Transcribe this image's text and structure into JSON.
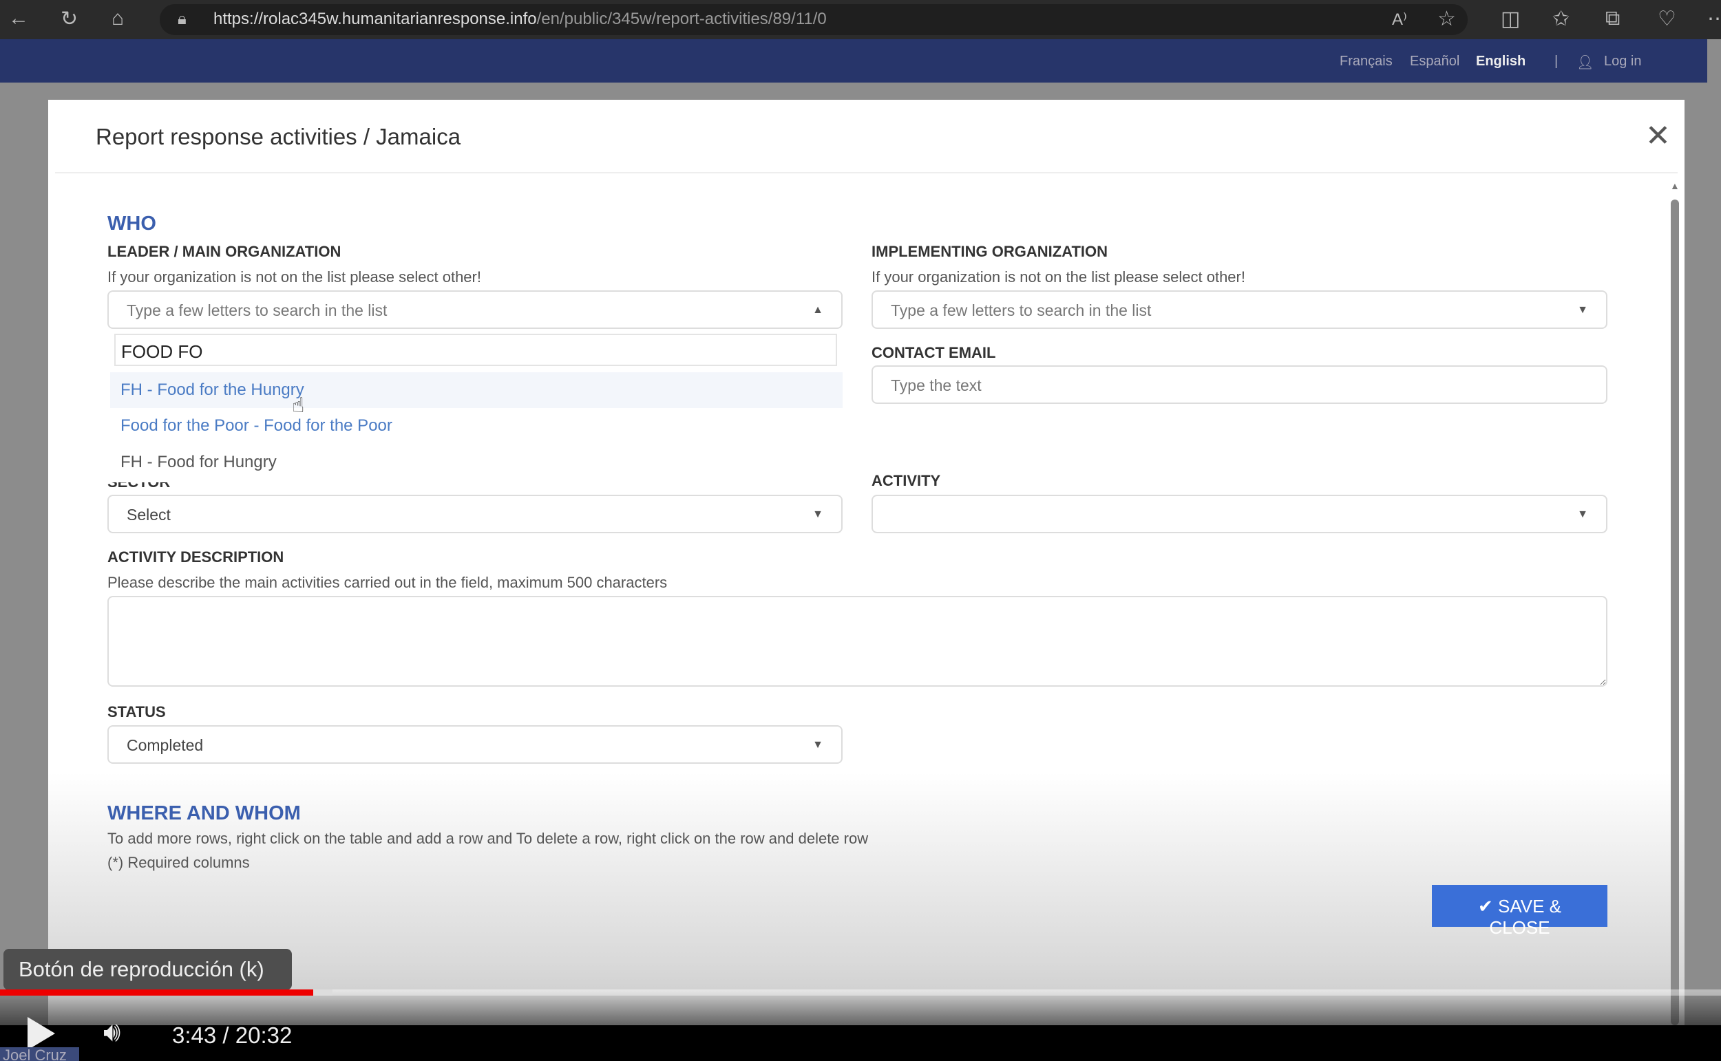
{
  "browser": {
    "url_host": "https://rolac345w.humanitarianresponse.info",
    "url_path": "/en/public/345w/report-activities/89/11/0",
    "icons": [
      "back-icon",
      "refresh-icon",
      "home-icon",
      "lock-icon",
      "read-aloud-icon",
      "favorite-icon",
      "split-screen-icon",
      "favorites-icon",
      "collections-icon",
      "extensions-icon",
      "more-icon"
    ]
  },
  "site": {
    "languages": [
      "Français",
      "Español",
      "English"
    ],
    "login": "Log in"
  },
  "modal": {
    "title": "Report response activities / Jamaica",
    "who": {
      "heading": "WHO",
      "leader_label": "LEADER / MAIN ORGANIZATION",
      "leader_help": "If your organization is not on the list please select other!",
      "leader_placeholder": "Type a few letters to search in the list",
      "search_value": "FOOD FO",
      "options": [
        "FH - Food for the Hungry",
        "Food for the Poor - Food for the Poor",
        "FH - Food for Hungry"
      ],
      "impl_label": "IMPLEMENTING ORGANIZATION",
      "impl_help": "If your organization is not on the list please select other!",
      "impl_placeholder": "Type a few letters to search in the list",
      "email_label": "CONTACT EMAIL",
      "email_placeholder": "Type the text",
      "sector_label": "SECTOR",
      "sector_value": "Select",
      "activity_label": "ACTIVITY",
      "activity_value": "",
      "desc_label": "ACTIVITY DESCRIPTION",
      "desc_help": "Please describe the main activities carried out in the field, maximum 500 characters",
      "status_label": "STATUS",
      "status_value": "Completed"
    },
    "where": {
      "heading": "WHERE AND WHOM",
      "help1": "To add more rows, right click on the table and add a row and To delete a row, right click on the row and delete row",
      "help2": "(*) Required columns"
    },
    "save_label": "SAVE & CLOSE"
  },
  "video": {
    "tooltip": "Botón de reproducción (k)",
    "time": "3:43 / 20:32",
    "progress_percent": 18.2,
    "buffered_percent": 19.3,
    "channel": "Joel Cruz"
  },
  "colors": {
    "accent": "#3b5fae",
    "button": "#3a6fd8",
    "progress": "#ee0000",
    "link": "#4a7bc4"
  }
}
